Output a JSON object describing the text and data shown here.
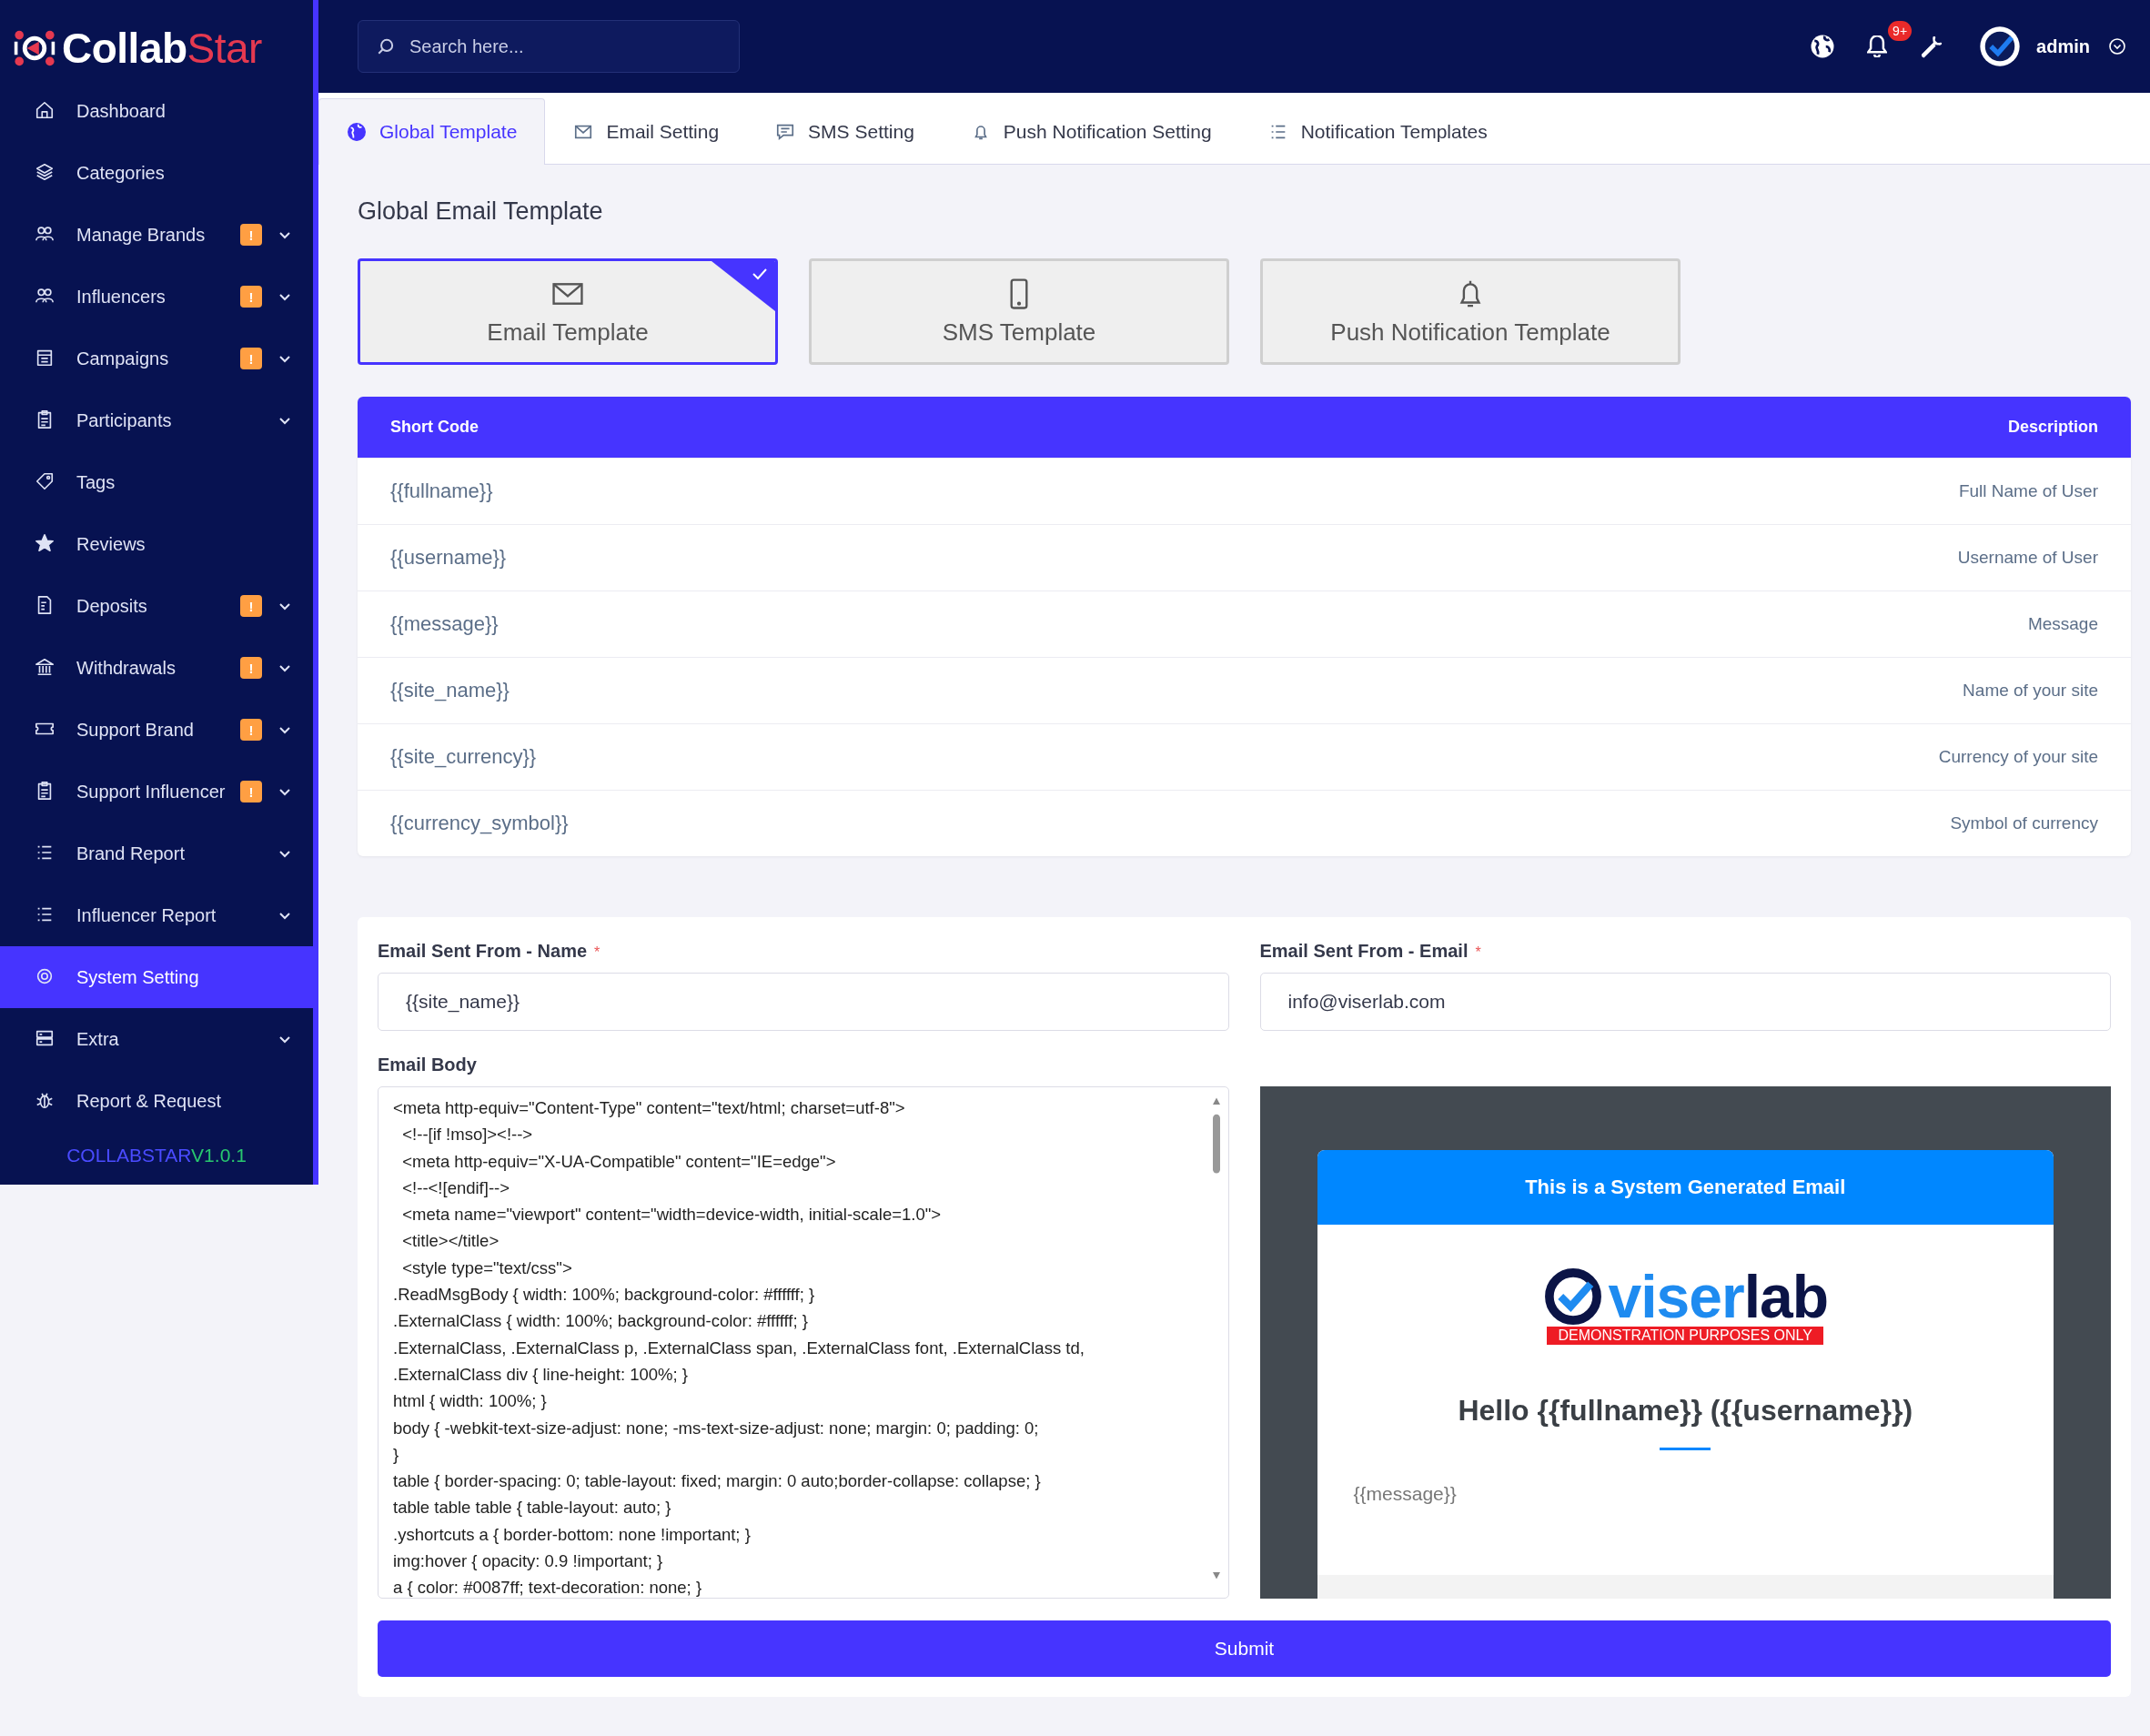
{
  "sidebar": {
    "logo": {
      "part_1": "Collab",
      "part_2": "Star"
    },
    "items": [
      {
        "label": "Dashboard",
        "has_submenu": false,
        "selected": false
      },
      {
        "label": "Categories",
        "has_submenu": false,
        "selected": false
      },
      {
        "label": "Manage Brands",
        "badge": "!",
        "has_submenu": true,
        "selected": false
      },
      {
        "label": "Influencers",
        "badge": "!",
        "has_submenu": true,
        "selected": false
      },
      {
        "label": "Campaigns",
        "badge": "!",
        "has_submenu": true,
        "selected": false
      },
      {
        "label": "Participants",
        "has_submenu": true,
        "selected": false
      },
      {
        "label": "Tags",
        "has_submenu": false,
        "selected": false
      },
      {
        "label": "Reviews",
        "has_submenu": false,
        "selected": false
      },
      {
        "label": "Deposits",
        "badge": "!",
        "has_submenu": true,
        "selected": false
      },
      {
        "label": "Withdrawals",
        "badge": "!",
        "has_submenu": true,
        "selected": false
      },
      {
        "label": "Support Brand",
        "badge": "!",
        "has_submenu": true,
        "selected": false
      },
      {
        "label": "Support Influencer",
        "badge": "!",
        "has_submenu": true,
        "selected": false
      },
      {
        "label": "Brand Report",
        "has_submenu": true,
        "selected": false
      },
      {
        "label": "Influencer Report",
        "has_submenu": true,
        "selected": false
      },
      {
        "label": "System Setting",
        "has_submenu": false,
        "selected": true
      },
      {
        "label": "Extra",
        "has_submenu": true,
        "selected": false
      },
      {
        "label": "Report & Request",
        "has_submenu": false,
        "selected": false
      }
    ],
    "footer": {
      "name": "COLLABSTAR",
      "version": "V1.0.1"
    }
  },
  "topbar": {
    "search": {
      "placeholder": "Search here..."
    },
    "notification_count": "9+",
    "user": "admin"
  },
  "tabs": [
    {
      "label": "Global Template",
      "selected": true
    },
    {
      "label": "Email Setting",
      "selected": false
    },
    {
      "label": "SMS Setting",
      "selected": false
    },
    {
      "label": "Push Notification Setting",
      "selected": false
    },
    {
      "label": "Notification Templates",
      "selected": false
    }
  ],
  "page_title": "Global Email Template",
  "template_cards": [
    {
      "label": "Email Template",
      "kind": "email",
      "selected": true
    },
    {
      "label": "SMS Template",
      "kind": "sms",
      "selected": false
    },
    {
      "label": "Push Notification Template",
      "kind": "push",
      "selected": false
    }
  ],
  "table": {
    "columns": [
      "Short Code",
      "Description"
    ],
    "rows": [
      [
        "{{fullname}}",
        "Full Name of User"
      ],
      [
        "{{username}}",
        "Username of User"
      ],
      [
        "{{message}}",
        "Message"
      ],
      [
        "{{site_name}}",
        "Name of your site"
      ],
      [
        "{{site_currency}}",
        "Currency of your site"
      ],
      [
        "{{currency_symbol}}",
        "Symbol of currency"
      ]
    ]
  },
  "form": {
    "fields": [
      {
        "label": "Email Sent From - Name",
        "required": true,
        "value": "{{site_name}}"
      },
      {
        "label": "Email Sent From - Email",
        "required": true,
        "value": "info@viserlab.com"
      }
    ],
    "required_mark": "*",
    "body_label": "Email Body",
    "body_lines": [
      "<meta http-equiv=\"Content-Type\" content=\"text/html; charset=utf-8\">",
      "  <!--[if !mso]><!-->",
      "  <meta http-equiv=\"X-UA-Compatible\" content=\"IE=edge\">",
      "  <!--<![endif]-->",
      "  <meta name=\"viewport\" content=\"width=device-width, initial-scale=1.0\">",
      "  <title></title>",
      "  <style type=\"text/css\">",
      ".ReadMsgBody { width: 100%; background-color: #ffffff; }",
      ".ExternalClass { width: 100%; background-color: #ffffff; }",
      ".ExternalClass, .ExternalClass p, .ExternalClass span, .ExternalClass font, .ExternalClass td,",
      ".ExternalClass div { line-height: 100%; }",
      "html { width: 100%; }",
      "body { -webkit-text-size-adjust: none; -ms-text-size-adjust: none; margin: 0; padding: 0;",
      "}",
      "table { border-spacing: 0; table-layout: fixed; margin: 0 auto;border-collapse: collapse; }",
      "table table table { table-layout: auto; }",
      ".yshortcuts a { border-bottom: none !important; }",
      "img:hover { opacity: 0.9 !important; }",
      "a { color: #0087ff; text-decoration: none; }"
    ],
    "preview": {
      "header": "This is a System Generated Email",
      "logo_part_1": "viser",
      "logo_part_2": "lab",
      "logo_banner": "DEMONSTRATION PURPOSES ONLY",
      "greeting": "Hello {{fullname}} ({{username}})",
      "message": "{{message}}"
    },
    "submit": "Submit"
  }
}
